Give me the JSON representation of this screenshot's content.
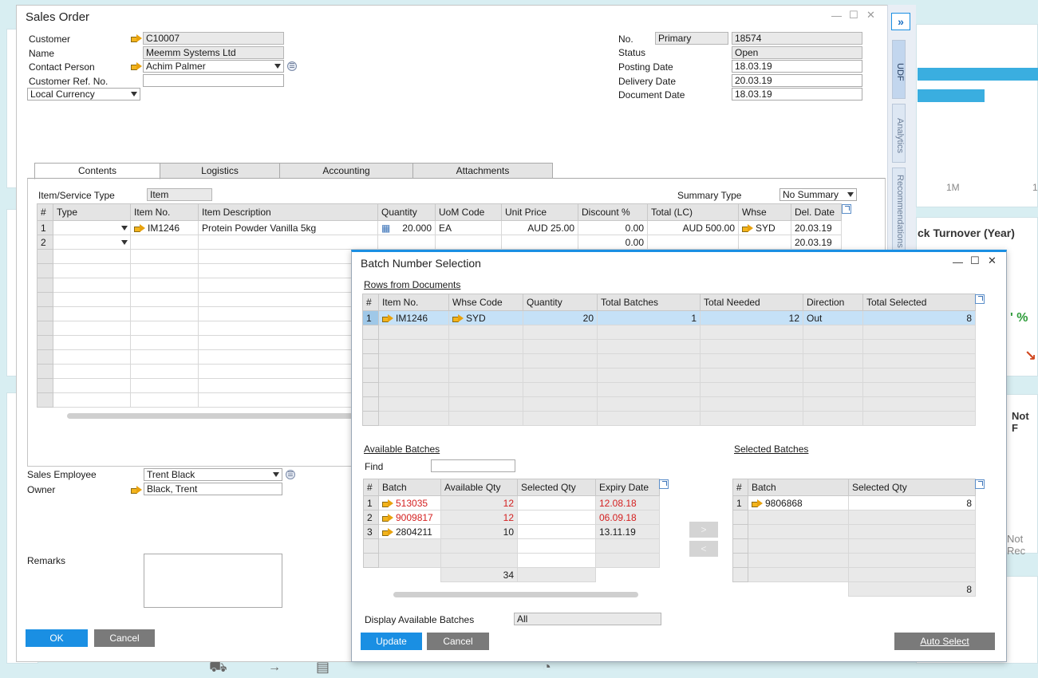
{
  "background": {
    "chart_title": "ck Turnover (Year)",
    "axis_tick_1": "1M",
    "axis_tick_2": "1",
    "percent_text": "' %",
    "not_text_1": "Not F",
    "not_text_2": "Not Rec"
  },
  "side_panel": {
    "collapse_symbol": "»",
    "tabs": [
      "UDF",
      "Analytics",
      "Recommendations"
    ]
  },
  "sales_order": {
    "title": "Sales Order",
    "fields": {
      "customer_label": "Customer",
      "customer_value": "C10007",
      "name_label": "Name",
      "name_value": "Meemm Systems Ltd",
      "contact_label": "Contact Person",
      "contact_value": "Achim Palmer",
      "custref_label": "Customer Ref. No.",
      "custref_value": "",
      "currency_value": "Local Currency",
      "no_label": "No.",
      "no_series": "Primary",
      "no_value": "18574",
      "status_label": "Status",
      "status_value": "Open",
      "posting_label": "Posting Date",
      "posting_value": "18.03.19",
      "delivery_label": "Delivery Date",
      "delivery_value": "20.03.19",
      "docdate_label": "Document Date",
      "docdate_value": "18.03.19"
    },
    "tabs": [
      "Contents",
      "Logistics",
      "Accounting",
      "Attachments"
    ],
    "contents": {
      "item_type_label": "Item/Service Type",
      "item_type_value": "Item",
      "summary_label": "Summary Type",
      "summary_value": "No Summary"
    },
    "grid": {
      "headers": [
        "#",
        "Type",
        "Item No.",
        "Item Description",
        "Quantity",
        "UoM Code",
        "Unit Price",
        "Discount %",
        "Total (LC)",
        "Whse",
        "Del. Date"
      ],
      "rows": [
        [
          "1",
          "",
          "IM1246",
          "Protein Powder Vanilla 5kg",
          "20.000",
          "EA",
          "AUD 25.00",
          "0.00",
          "AUD 500.00",
          "SYD",
          "20.03.19"
        ],
        [
          "2",
          "",
          "",
          "",
          "",
          "",
          "",
          "0.00",
          "",
          "",
          "20.03.19"
        ]
      ]
    },
    "bottom": {
      "employee_label": "Sales Employee",
      "employee_value": "Trent Black",
      "owner_label": "Owner",
      "owner_value": "Black, Trent",
      "remarks_label": "Remarks",
      "remarks_value": ""
    },
    "buttons": {
      "ok": "OK",
      "cancel": "Cancel"
    }
  },
  "batch_dialog": {
    "title": "Batch Number Selection",
    "rows_section": "Rows from Documents",
    "rows_headers": [
      "#",
      "Item No.",
      "Whse Code",
      "Quantity",
      "Total Batches",
      "Total Needed",
      "Direction",
      "Total Selected"
    ],
    "rows": [
      [
        "1",
        "IM1246",
        "SYD",
        "20",
        "1",
        "12",
        "Out",
        "8"
      ]
    ],
    "available_section": "Available Batches",
    "find_label": "Find",
    "find_value": "",
    "avail_headers": [
      "#",
      "Batch",
      "Available Qty",
      "Selected Qty",
      "Expiry Date"
    ],
    "avail_rows": [
      [
        "1",
        "513035",
        "12",
        "",
        "12.08.18"
      ],
      [
        "2",
        "9009817",
        "12",
        "",
        "06.09.18"
      ],
      [
        "3",
        "2804211",
        "10",
        "",
        "13.11.19"
      ]
    ],
    "avail_total": "34",
    "selected_section": "Selected Batches",
    "sel_headers": [
      "#",
      "Batch",
      "Selected Qty"
    ],
    "sel_rows": [
      [
        "1",
        "9806868",
        "8"
      ]
    ],
    "sel_total": "8",
    "move_right": ">",
    "move_left": "<",
    "display_label": "Display Available Batches",
    "display_value": "All",
    "buttons": {
      "update": "Update",
      "cancel": "Cancel",
      "auto_select": "Auto Select"
    }
  },
  "colors": {
    "accent": "#1a8fe3",
    "expired": "#d41f1f",
    "selected_row": "#c5e1f7"
  }
}
